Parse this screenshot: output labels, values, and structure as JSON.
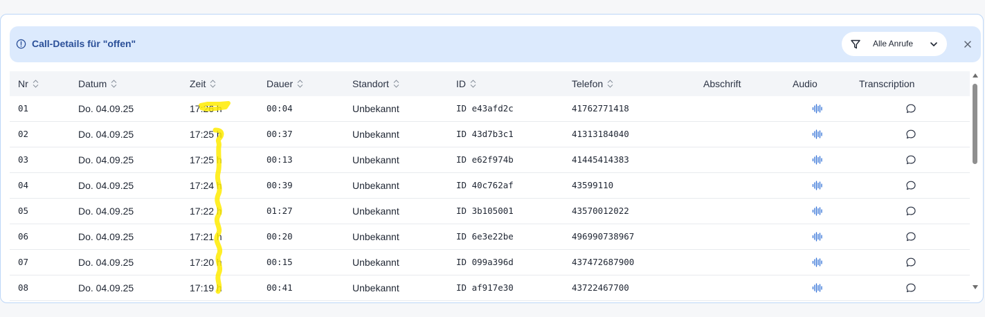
{
  "banner": {
    "title": "Call-Details für \"offen\"",
    "filter_label": "Alle Anrufe"
  },
  "columns": {
    "nr": "Nr",
    "datum": "Datum",
    "zeit": "Zeit",
    "dauer": "Dauer",
    "standort": "Standort",
    "id": "ID",
    "telefon": "Telefon",
    "abschrift": "Abschrift",
    "audio": "Audio",
    "transcription": "Transcription"
  },
  "rows": [
    {
      "nr": "01",
      "datum": "Do. 04.09.25",
      "zeit": "17:26 h",
      "dauer": "00:04",
      "standort": "Unbekannt",
      "id": "ID e43afd2c",
      "telefon": "41762771418"
    },
    {
      "nr": "02",
      "datum": "Do. 04.09.25",
      "zeit": "17:25 h",
      "dauer": "00:37",
      "standort": "Unbekannt",
      "id": "ID 43d7b3c1",
      "telefon": "41313184040"
    },
    {
      "nr": "03",
      "datum": "Do. 04.09.25",
      "zeit": "17:25 h",
      "dauer": "00:13",
      "standort": "Unbekannt",
      "id": "ID e62f974b",
      "telefon": "41445414383"
    },
    {
      "nr": "04",
      "datum": "Do. 04.09.25",
      "zeit": "17:24 h",
      "dauer": "00:39",
      "standort": "Unbekannt",
      "id": "ID 40c762af",
      "telefon": "43599110"
    },
    {
      "nr": "05",
      "datum": "Do. 04.09.25",
      "zeit": "17:22 h",
      "dauer": "01:27",
      "standort": "Unbekannt",
      "id": "ID 3b105001",
      "telefon": "43570012022"
    },
    {
      "nr": "06",
      "datum": "Do. 04.09.25",
      "zeit": "17:21 h",
      "dauer": "00:20",
      "standort": "Unbekannt",
      "id": "ID 6e3e22be",
      "telefon": "496990738967"
    },
    {
      "nr": "07",
      "datum": "Do. 04.09.25",
      "zeit": "17:20 h",
      "dauer": "00:15",
      "standort": "Unbekannt",
      "id": "ID 099a396d",
      "telefon": "437472687900"
    },
    {
      "nr": "08",
      "datum": "Do. 04.09.25",
      "zeit": "17:19 h",
      "dauer": "00:41",
      "standort": "Unbekannt",
      "id": "ID af917e30",
      "telefon": "43722467700"
    }
  ],
  "icons": {
    "info": "info-icon",
    "filter": "filter-icon",
    "dropdown": "chevron-down-icon",
    "close": "close-icon",
    "sort": "sort-icon",
    "audio": "audio-waveform-icon",
    "transcription": "chat-bubble-icon"
  },
  "colors": {
    "banner_bg": "#dceafd",
    "banner_text": "#2a4f98",
    "audio_icon": "#2f6fd6",
    "highlight": "#ffeb00"
  }
}
